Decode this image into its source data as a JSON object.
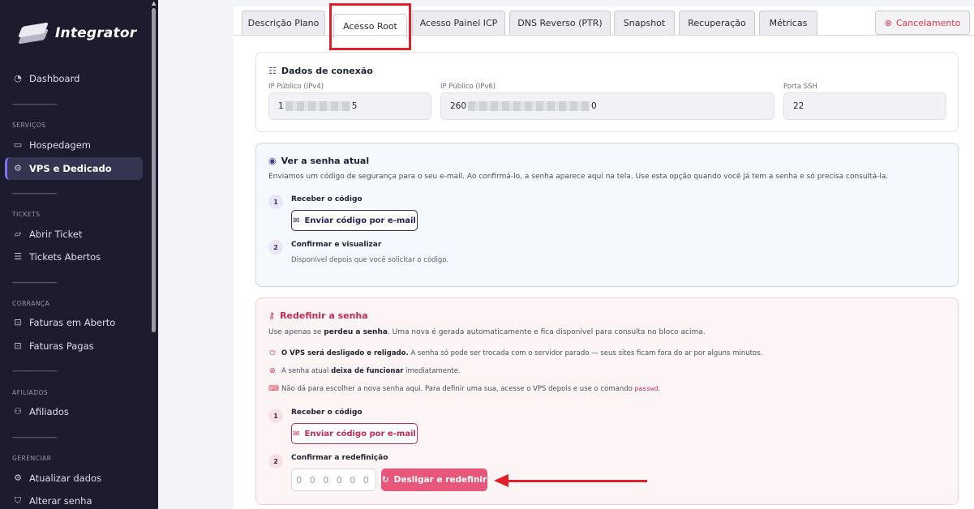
{
  "brand": {
    "name": "Integrator"
  },
  "sidebar": {
    "separator": "-----------------------------",
    "dashboard": "Dashboard",
    "sections": {
      "servicos": "SERVIÇOS",
      "tickets": "TICKETS",
      "cobranca": "COBRANÇA",
      "afiliados": "AFILIADOS",
      "gerenciar": "GERENCIAR"
    },
    "items": {
      "hospedagem": "Hospedagem",
      "vps": "VPS e Dedicado",
      "abrir_ticket": "Abrir Ticket",
      "tickets_abertos": "Tickets Abertos",
      "faturas_aberto": "Faturas em Aberto",
      "faturas_pagas": "Faturas Pagas",
      "afiliados": "Afiliados",
      "atualizar": "Atualizar dados",
      "alterar_senha": "Alterar senha"
    }
  },
  "tabs": {
    "descricao": "Descrição Plano",
    "acesso_root": "Acesso Root",
    "painel_icp": "Acesso Painel ICP",
    "dns": "DNS Reverso (PTR)",
    "snapshot": "Snapshot",
    "recuperacao": "Recuperação",
    "metricas": "Métricas",
    "cancelamento": "Cancelamento",
    "active": "Acesso Root"
  },
  "connection": {
    "title": "Dados de conexão",
    "ipv4_label": "IP Público (IPv4)",
    "ipv4_prefix": "1",
    "ipv4_suffix": "5",
    "ipv6_label": "IP Público (IPv6)",
    "ipv6_prefix": "260",
    "ipv6_suffix": "0",
    "ssh_label": "Porta SSH",
    "ssh_value": "22"
  },
  "view_password": {
    "title": "Ver a senha atual",
    "description": "Enviamos um código de segurança para o seu e-mail. Ao confirmá-lo, a senha aparece aqui na tela. Use esta opção quando você já tem a senha e só precisa consultá-la.",
    "step1_num": "1",
    "step1_title": "Receber o código",
    "send_button": "Enviar código por e-mail",
    "step2_num": "2",
    "step2_title": "Confirmar e visualizar",
    "step2_desc": "Disponível depois que você solicitar o código."
  },
  "reset_password": {
    "title": "Redefinir a senha",
    "desc_pre": "Use apenas se ",
    "desc_bold": "perdeu a senha",
    "desc_post": ". Uma nova é gerada automaticamente e fica disponível para consulta no bloco acima.",
    "warn1_bold": "O VPS será desligado e religado.",
    "warn1_text": " A senha só pode ser trocada com o servidor parado — seus sites ficam fora do ar por alguns minutos.",
    "warn2_pre": "A senha atual ",
    "warn2_bold": "deixa de funcionar",
    "warn2_post": " imediatamente.",
    "warn3_text": "Não dá para escolher a nova senha aqui. Para definir uma sua, acesse o VPS depois e use o comando ",
    "warn3_code": "passwd",
    "warn3_end": ".",
    "step1_num": "1",
    "step1_title": "Receber o código",
    "send_button": "Enviar código por e-mail",
    "step2_num": "2",
    "step2_title": "Confirmar a redefinição",
    "code_placeholder": "000000",
    "reset_button": "Desligar e redefinir"
  },
  "colors": {
    "accent": "#8a6cf0",
    "danger": "#e0202a",
    "reset_btn": "#e8577a",
    "sidebar_bg": "#1c1c2e"
  },
  "icons": [
    "dashboard-icon",
    "monitor-icon",
    "server-icon",
    "ticket-icon",
    "list-icon",
    "invoice-icon",
    "users-icon",
    "settings-icon",
    "shield-icon",
    "eye-icon",
    "key-icon",
    "mail-icon",
    "power-icon",
    "x-circle-icon",
    "terminal-icon",
    "refresh-icon"
  ]
}
